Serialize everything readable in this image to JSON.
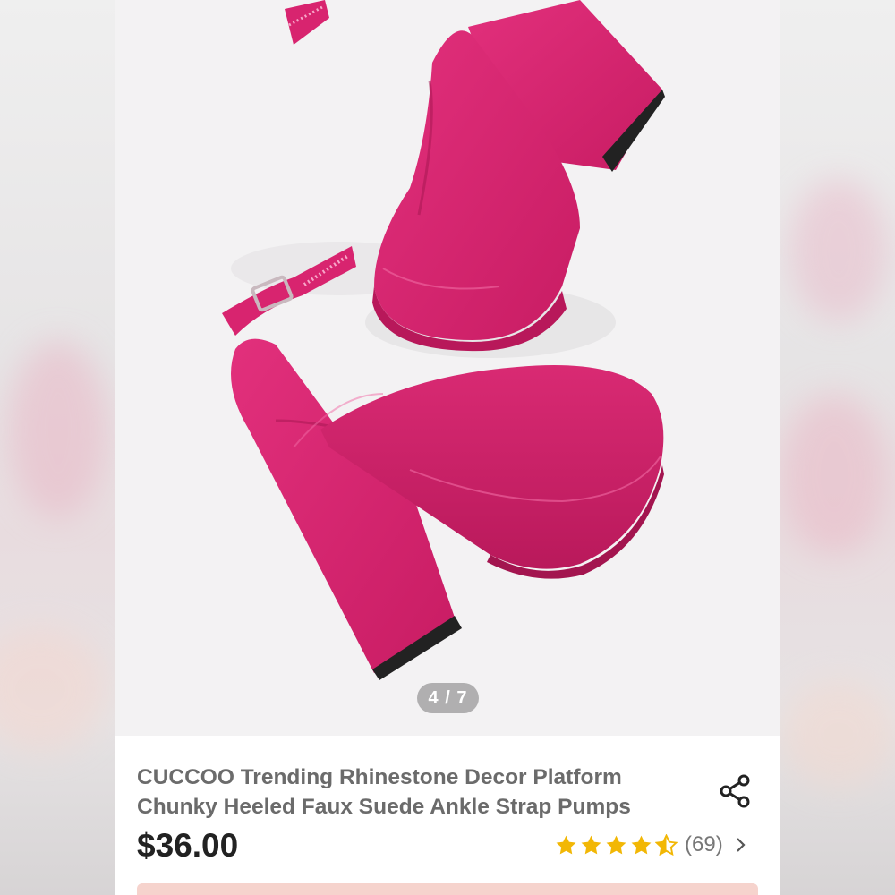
{
  "carousel": {
    "indicator": "4 / 7"
  },
  "product": {
    "title_line1": "CUCCOO Trending Rhinestone Decor Platform",
    "title_line2": "Chunky Heeled Faux Suede Ankle Strap Pumps",
    "price": "$36.00",
    "rating": 4.5,
    "review_count": "(69)"
  },
  "icons": {
    "share": "share-icon",
    "star": "star-icon",
    "chevron": "chevron-right-icon"
  },
  "colors": {
    "shoe": "#d8246f",
    "star": "#f2b705",
    "price": "#222222",
    "title": "#6b6b6b",
    "cta": "#f6d3cd"
  }
}
